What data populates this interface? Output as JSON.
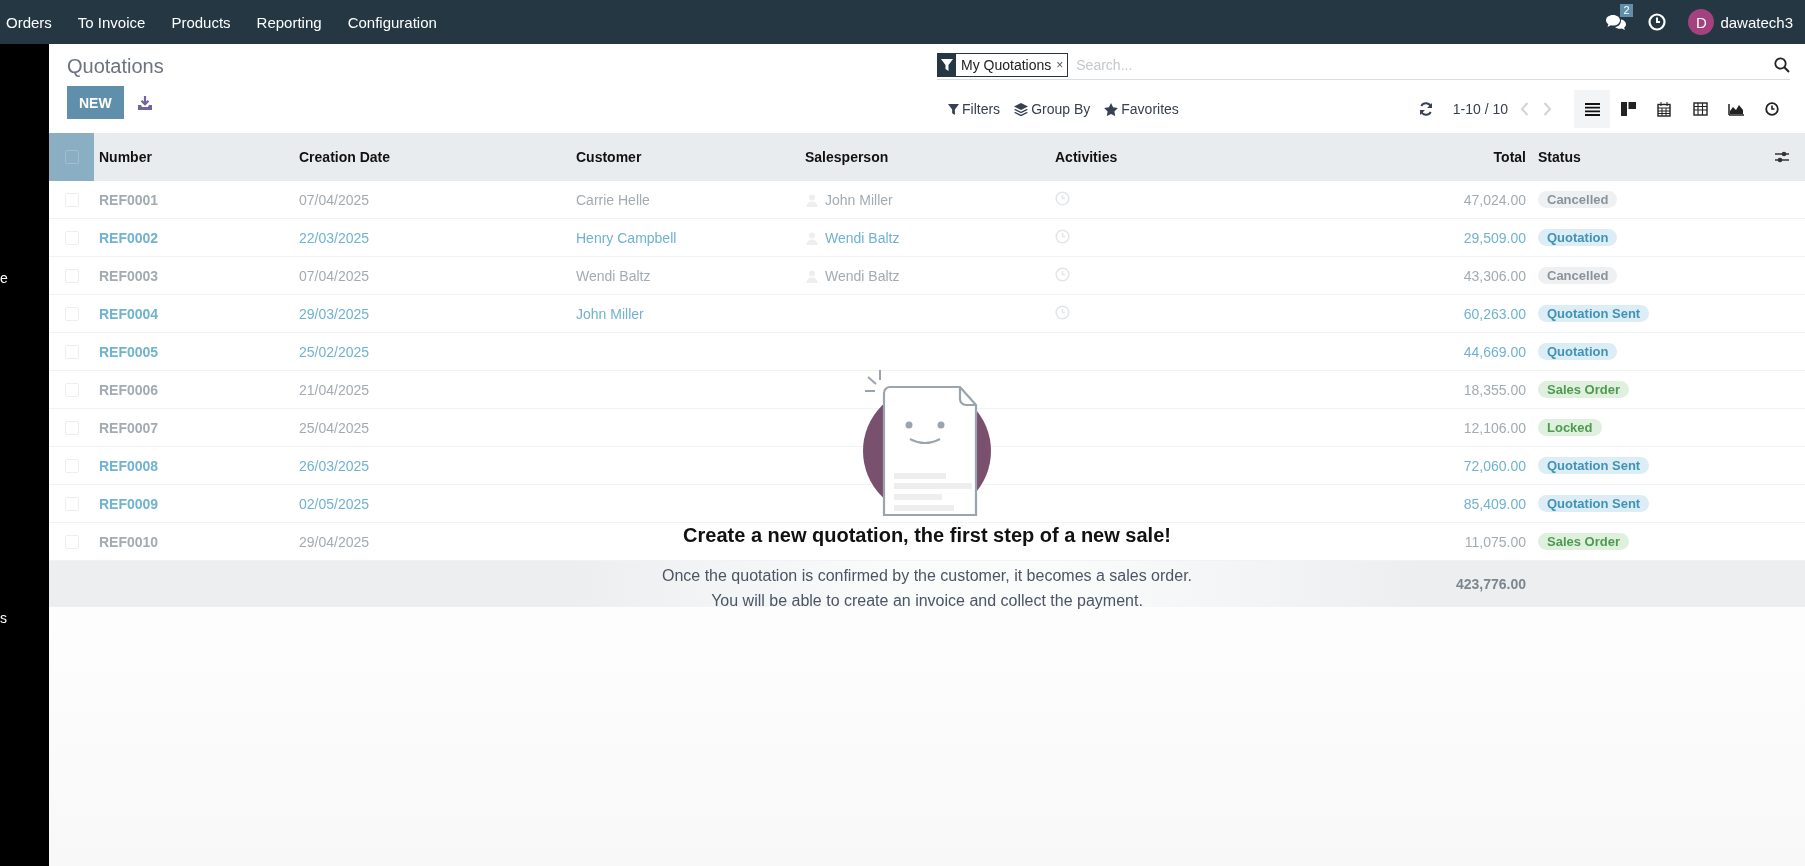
{
  "navbar": {
    "menu": [
      "Orders",
      "To Invoice",
      "Products",
      "Reporting",
      "Configuration"
    ],
    "messages_count": "2",
    "user": {
      "initial": "D",
      "name": "dawatech3"
    }
  },
  "sidebar_fragments": [
    "e",
    "s"
  ],
  "control_panel": {
    "title": "Quotations",
    "new_button": "NEW",
    "search": {
      "facet": "My Quotations",
      "facet_remove": "×",
      "placeholder": "Search..."
    },
    "actions": [
      {
        "label": "Filters",
        "kind": "filter"
      },
      {
        "label": "Group By",
        "kind": "layers"
      },
      {
        "label": "Favorites",
        "kind": "star"
      }
    ],
    "pager": "1-10 / 10",
    "views": [
      {
        "kind": "list",
        "selected": true
      },
      {
        "kind": "kanban",
        "selected": false
      },
      {
        "kind": "calendar",
        "selected": false
      },
      {
        "kind": "pivot",
        "selected": false
      },
      {
        "kind": "graph",
        "selected": false
      },
      {
        "kind": "activity",
        "selected": false
      }
    ]
  },
  "table": {
    "select_all_checked": false,
    "columns": [
      "Number",
      "Creation Date",
      "Customer",
      "Salesperson",
      "Activities",
      "Total",
      "Status"
    ],
    "rows": [
      {
        "number": "REF0001",
        "date": "07/04/2025",
        "customer": "Carrie Helle",
        "salesperson": "John Miller",
        "activity": true,
        "total": "47,024.00",
        "status": {
          "label": "Cancelled",
          "kind": "cancelled"
        },
        "highlighted": false
      },
      {
        "number": "REF0002",
        "date": "22/03/2025",
        "customer": "Henry Campbell",
        "salesperson": "Wendi Baltz",
        "activity": true,
        "total": "29,509.00",
        "status": {
          "label": "Quotation",
          "kind": "draft"
        },
        "highlighted": true
      },
      {
        "number": "REF0003",
        "date": "07/04/2025",
        "customer": "Wendi Baltz",
        "salesperson": "Wendi Baltz",
        "activity": true,
        "total": "43,306.00",
        "status": {
          "label": "Cancelled",
          "kind": "cancelled"
        },
        "highlighted": false
      },
      {
        "number": "REF0004",
        "date": "29/03/2025",
        "customer": "John Miller",
        "activity": true,
        "total": "60,263.00",
        "status": {
          "label": "Quotation Sent",
          "kind": "sent"
        },
        "highlighted": true
      },
      {
        "number": "REF0005",
        "date": "25/02/2025",
        "activity": false,
        "total": "44,669.00",
        "status": {
          "label": "Quotation",
          "kind": "draft"
        },
        "highlighted": true
      },
      {
        "number": "REF0006",
        "date": "21/04/2025",
        "activity": false,
        "total": "18,355.00",
        "status": {
          "label": "Sales Order",
          "kind": "sale"
        },
        "highlighted": false
      },
      {
        "number": "REF0007",
        "date": "25/04/2025",
        "activity": false,
        "total": "12,106.00",
        "status": {
          "label": "Locked",
          "kind": "locked"
        },
        "highlighted": false
      },
      {
        "number": "REF0008",
        "date": "26/03/2025",
        "activity": false,
        "total": "72,060.00",
        "status": {
          "label": "Quotation Sent",
          "kind": "sent"
        },
        "highlighted": true
      },
      {
        "number": "REF0009",
        "date": "02/05/2025",
        "activity": false,
        "total": "85,409.00",
        "status": {
          "label": "Quotation Sent",
          "kind": "sent"
        },
        "highlighted": true
      },
      {
        "number": "REF0010",
        "date": "29/04/2025",
        "activity": false,
        "total": "11,075.00",
        "status": {
          "label": "Sales Order",
          "kind": "sale"
        },
        "highlighted": false
      }
    ],
    "footer_total": "423,776.00"
  },
  "empty_state": {
    "title": "Create a new quotation, the first step of a new sale!",
    "lines": [
      "Once the quotation is confirmed by the customer, it becomes a sales order.",
      "You will be able to create an invoice and collect the payment."
    ]
  }
}
